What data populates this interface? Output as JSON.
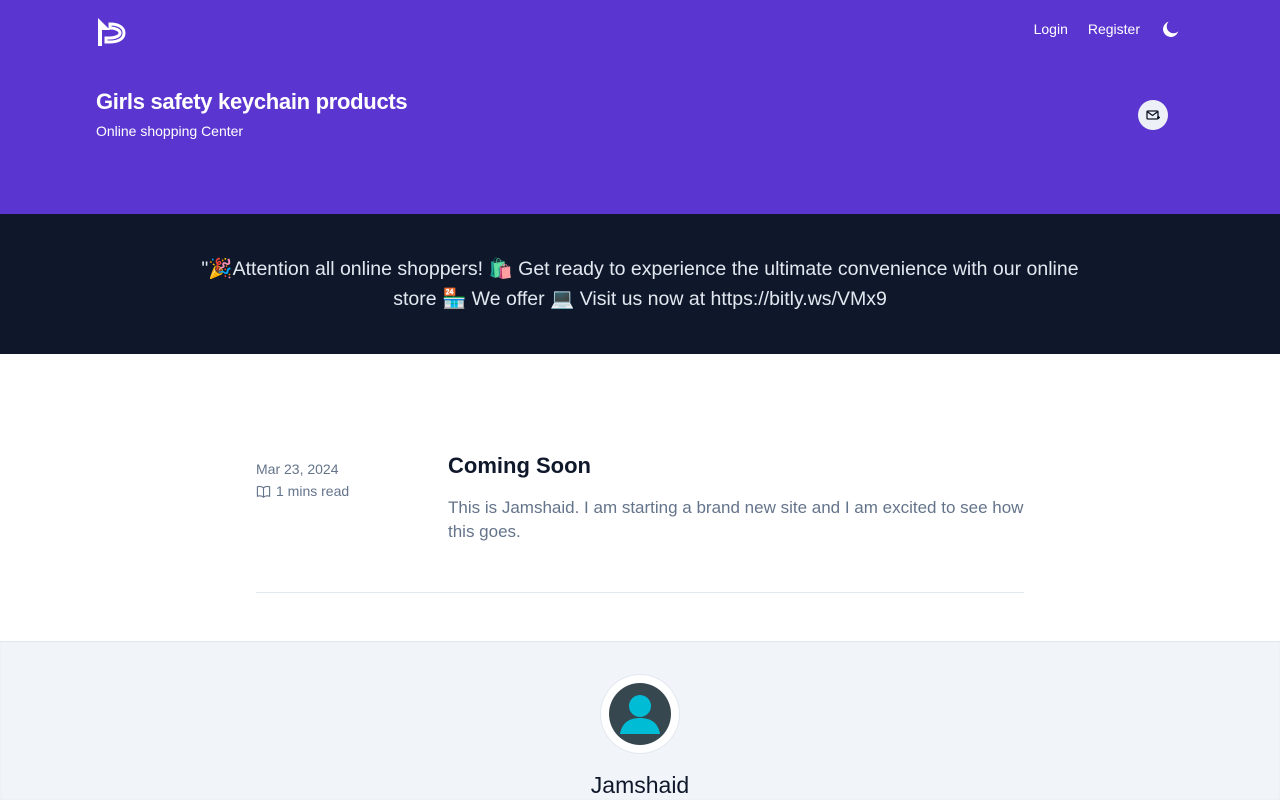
{
  "nav": {
    "login": "Login",
    "register": "Register"
  },
  "site": {
    "title": "Girls safety keychain products",
    "subtitle": "Online shopping Center"
  },
  "banner": {
    "text": "\"🎉Attention all online shoppers! 🛍️ Get ready to experience the ultimate convenience with our online store 🏪 We offer 💻 Visit us now at https://bitly.ws/VMx9"
  },
  "posts": [
    {
      "date": "Mar 23, 2024",
      "read_time": "1 mins read",
      "title": "Coming Soon",
      "excerpt": "This is Jamshaid. I am starting a brand new site and I am excited to see how this goes."
    }
  ],
  "author": {
    "name": "Jamshaid"
  },
  "colors": {
    "header": "#5a35d0",
    "banner": "#0f172a",
    "author_bg": "#f1f5f9",
    "avatar": "#00bcd4"
  },
  "icons": {
    "logo": "hashnode-style-logo",
    "theme": "moon-icon",
    "subscribe": "mail-plus-icon",
    "read": "book-open-icon"
  }
}
